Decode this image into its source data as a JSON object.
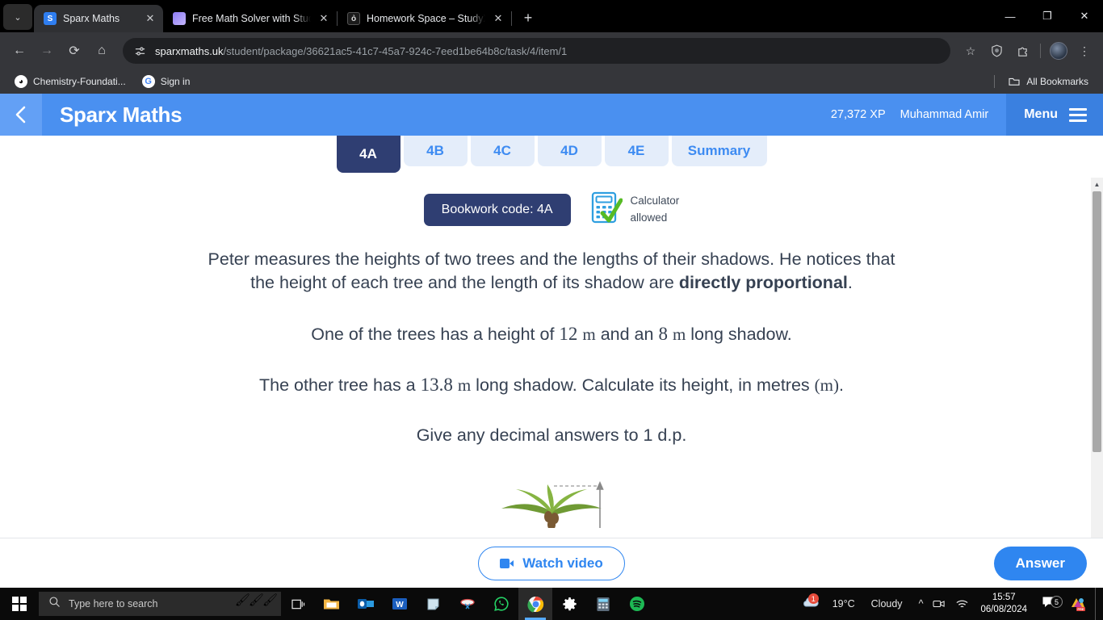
{
  "browser": {
    "tabs": [
      {
        "title": "Sparx Maths",
        "favicon": "sparx-favicon",
        "active": true
      },
      {
        "title": "Free Math Solver with StudyX M",
        "favicon": "studyx-favicon",
        "active": false
      },
      {
        "title": "Homework Space – StudyX",
        "favicon": "homework-favicon",
        "active": false
      }
    ],
    "tab_close_label": "✕",
    "new_tab_label": "+",
    "tab_list_chevron": "⌄",
    "window_controls": {
      "minimize": "—",
      "maximize": "❐",
      "close": "✕"
    },
    "nav": {
      "back": "←",
      "forward": "→",
      "reload": "⟳",
      "home": "⌂"
    },
    "omnibox": {
      "site_settings_icon": "tune-icon",
      "url_domain": "sparxmaths.uk",
      "url_path": "/student/package/36621ac5-41c7-45a7-924c-7eed1be64b8c/task/4/item/1"
    },
    "toolbar_icons": {
      "bookmark_star": "☆",
      "shield": "shield-icon",
      "extensions": "puzzle-icon",
      "profile": "avatar",
      "menu": "⋮"
    },
    "bookmarks": [
      {
        "label": "Chemistry-Foundati...",
        "icon": "chemistry-icon"
      },
      {
        "label": "Sign in",
        "icon": "google-icon"
      }
    ],
    "all_bookmarks_label": "All Bookmarks",
    "all_bookmarks_icon": "folder-icon"
  },
  "sparx": {
    "back_icon": "chevron-left-icon",
    "brand": "Sparx Maths",
    "xp": "27,372 XP",
    "username": "Muhammad Amir",
    "menu_label": "Menu",
    "menu_icon": "hamburger-icon",
    "question_tabs": [
      {
        "label": "4A",
        "active": true
      },
      {
        "label": "4B",
        "active": false
      },
      {
        "label": "4C",
        "active": false
      },
      {
        "label": "4D",
        "active": false
      },
      {
        "label": "4E",
        "active": false
      },
      {
        "label": "Summary",
        "active": false
      }
    ],
    "bookwork_code": "Bookwork code: 4A",
    "calculator": {
      "icon": "calculator-check-icon",
      "line1": "Calculator",
      "line2": "allowed"
    },
    "question": {
      "para1_a": "Peter measures the heights of two trees and the lengths of their shadows. He notices that the height of each tree and the length of its shadow are ",
      "para1_bold": "directly proportional",
      "para1_b": ".",
      "para2_a": "One of the trees has a height of ",
      "para2_num1": "12",
      "para2_unit1": "m",
      "para2_b": " and an ",
      "para2_num2": "8",
      "para2_unit2": "m",
      "para2_c": " long shadow.",
      "para3_a": "The other tree has a ",
      "para3_num": "13.8",
      "para3_unit": "m",
      "para3_b": " long shadow. Calculate its height, in metres ",
      "para3_paren": "(m)",
      "para3_c": ".",
      "para4": "Give any decimal answers to 1 d.p."
    },
    "illustration": "palm-tree-with-height-arrow",
    "scrollbar": {
      "up_arrow": "▲",
      "down_arrow": "▼"
    },
    "actions": {
      "watch_video_label": "Watch video",
      "watch_video_icon": "video-camera-icon",
      "answer_label": "Answer"
    },
    "colors": {
      "header_blue": "#4a90f0",
      "accent_blue": "#2f86f0",
      "navy": "#2f3e72",
      "tab_light": "#e4edfa",
      "text": "#364152"
    }
  },
  "taskbar": {
    "start_icon": "windows-logo-icon",
    "search_placeholder": "Type here to search",
    "search_icon": "magnifier-icon",
    "search_decoration": "paintbrushes-icon",
    "task_view_icon": "task-view-icon",
    "apps": [
      {
        "name": "file-explorer",
        "glyph": "🗂"
      },
      {
        "name": "outlook",
        "glyph": "O"
      },
      {
        "name": "word",
        "glyph": "W"
      },
      {
        "name": "sticky-notes",
        "glyph": "▤"
      },
      {
        "name": "snipping-tool",
        "glyph": "✂"
      },
      {
        "name": "whatsapp",
        "glyph": "✆"
      },
      {
        "name": "chrome",
        "glyph": "◉",
        "active": true
      },
      {
        "name": "settings",
        "glyph": "⚙"
      },
      {
        "name": "calculator",
        "glyph": "▦"
      },
      {
        "name": "spotify",
        "glyph": "♫"
      }
    ],
    "tray": {
      "weather_icon": "cloud-icon",
      "weather_badge": "1",
      "temperature": "19°C",
      "condition": "Cloudy",
      "overflow_icon": "^",
      "camera_icon": "camera-icon",
      "wifi_icon": "wifi-icon",
      "time": "15:57",
      "date": "06/08/2024",
      "notification_icon": "speech-bubble-icon",
      "notification_count": "5",
      "pre_icon": "pre-app-icon"
    }
  }
}
